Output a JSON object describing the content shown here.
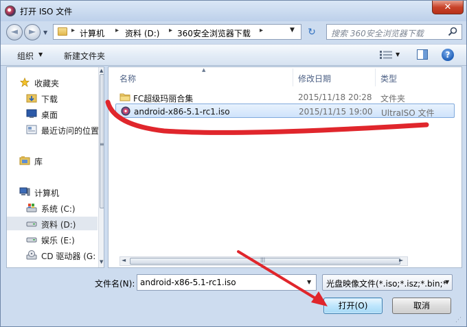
{
  "window": {
    "title": "打开 ISO 文件",
    "close_glyph": "✕"
  },
  "nav": {
    "back_glyph": "◄",
    "forward_glyph": "►",
    "history_glyph": "▼",
    "breadcrumb": [
      "计算机",
      "资料 (D:)",
      "360安全浏览器下载"
    ],
    "crumb_sep": "▸",
    "address_dropdown": "▼",
    "refresh_glyph": "↻",
    "search_placeholder": "搜索 360安全浏览器下载"
  },
  "toolbar": {
    "organize": "组织",
    "organize_arrow": "▼",
    "new_folder": "新建文件夹",
    "views_arrow": "▼",
    "help": "?"
  },
  "sidebar": {
    "favorites": "收藏夹",
    "fav_items": [
      "下载",
      "桌面",
      "最近访问的位置"
    ],
    "library": "库",
    "computer": "计算机",
    "drives": [
      "系统 (C:)",
      "资料 (D:)",
      "娱乐 (E:)",
      "CD 驱动器 (G:"
    ],
    "selected_drive": "资料 (D:)",
    "scroll_up": "▲",
    "scroll_down": "▼",
    "scroll_grip": "≡"
  },
  "filelist": {
    "columns": [
      "名称",
      "修改日期",
      "类型"
    ],
    "sort_arrow": "▲",
    "rows": [
      {
        "name": "FC超级玛丽合集",
        "date": "2015/11/18 20:28",
        "type": "文件夹",
        "icon": "folder-icon"
      },
      {
        "name": "android-x86-5.1-rc1.iso",
        "date": "2015/11/15 19:00",
        "type": "UltraISO 文件",
        "icon": "iso-disc-icon",
        "selected": true
      }
    ],
    "hscroll_left": "◄",
    "hscroll_right": "►",
    "hscroll_grip": "|||"
  },
  "bottom": {
    "filename_label": "文件名(N):",
    "filename_value": "android-x86-5.1-rc1.iso",
    "filename_dropdown": "▼",
    "filter_value": "光盘映像文件(*.iso;*.isz;*.bin;*",
    "filter_dropdown": "▼",
    "open_button": "打开(O)",
    "cancel_button": "取消",
    "resize_grip": "⋰"
  },
  "colors": {
    "annotation_red": "#e0262c",
    "selection_blue": "#cfe3fb",
    "window_frame": "#cddcef"
  }
}
